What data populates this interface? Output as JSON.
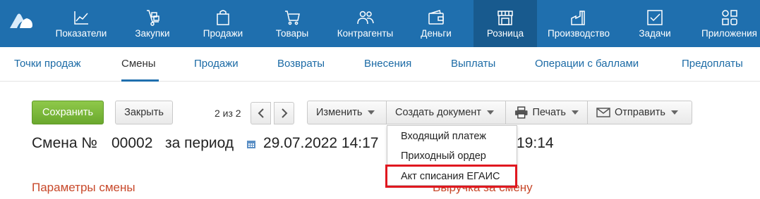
{
  "topnav": {
    "items": [
      {
        "label": "Показатели",
        "icon": "chart-line-icon"
      },
      {
        "label": "Закупки",
        "icon": "cart-dolly-icon"
      },
      {
        "label": "Продажи",
        "icon": "shopping-bag-icon"
      },
      {
        "label": "Товары",
        "icon": "shopping-cart-icon"
      },
      {
        "label": "Контрагенты",
        "icon": "users-icon"
      },
      {
        "label": "Деньги",
        "icon": "wallet-icon"
      },
      {
        "label": "Розница",
        "icon": "store-icon",
        "active": true
      },
      {
        "label": "Производство",
        "icon": "factory-icon"
      },
      {
        "label": "Задачи",
        "icon": "checkbox-icon"
      },
      {
        "label": "Приложения",
        "icon": "apps-icon"
      }
    ],
    "bg_color": "#1f6fae",
    "active_color": "#185a8e"
  },
  "subnav": {
    "items": [
      "Точки продаж",
      "Смены",
      "Продажи",
      "Возвраты",
      "Внесения",
      "Выплаты",
      "Операции с баллами",
      "Предоплаты"
    ],
    "active": "Смены"
  },
  "toolbar": {
    "save_label": "Сохранить",
    "close_label": "Закрыть",
    "pager": "2 из 2",
    "edit_label": "Изменить",
    "create_doc_label": "Создать документ",
    "print_label": "Печать",
    "send_label": "Отправить"
  },
  "title": {
    "prefix": "Смена №",
    "number": "00002",
    "period_label": "за период",
    "date_start": "29.07.2022 14:17",
    "date_end_visible": "19:14"
  },
  "dropdown": {
    "items": [
      "Входящий платеж",
      "Приходный ордер",
      "Акт списания ЕГАИС"
    ],
    "highlighted": "Акт списания ЕГАИС",
    "highlight_color": "#e0171f"
  },
  "sections": {
    "left": "Параметры смены",
    "right": "Выручка за смену"
  }
}
